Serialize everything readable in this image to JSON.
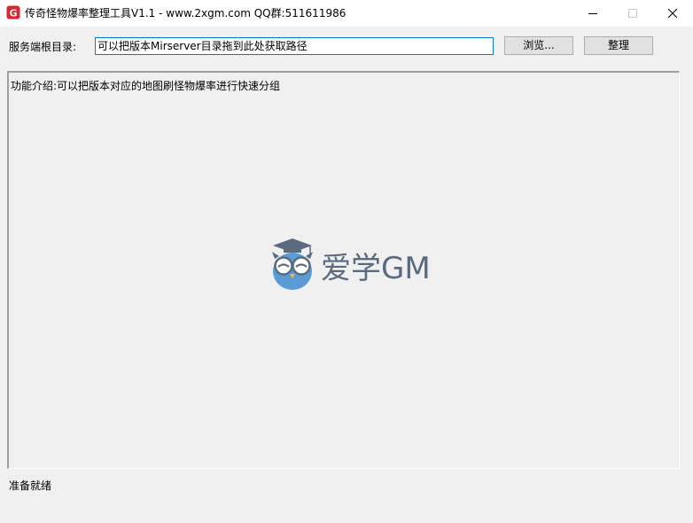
{
  "window": {
    "title": "传奇怪物爆率整理工具V1.1 - www.2xgm.com QQ群:511611986",
    "app_icon_letter": "G",
    "accent_color": "#d9262c"
  },
  "toolbar": {
    "root_label": "服务端根目录:",
    "path_value": "可以把版本Mirserver目录拖到此处获取路径",
    "browse_label": "浏览...",
    "organize_label": "整理"
  },
  "main": {
    "intro": "功能介绍:可以把版本对应的地图刷怪物爆率进行快速分组",
    "watermark": {
      "text": "爱学GM",
      "icon": "owl-mascot-icon",
      "color": "#5b6b7f",
      "owl_color": "#5b9bd5"
    }
  },
  "status": {
    "text": "准备就绪"
  }
}
